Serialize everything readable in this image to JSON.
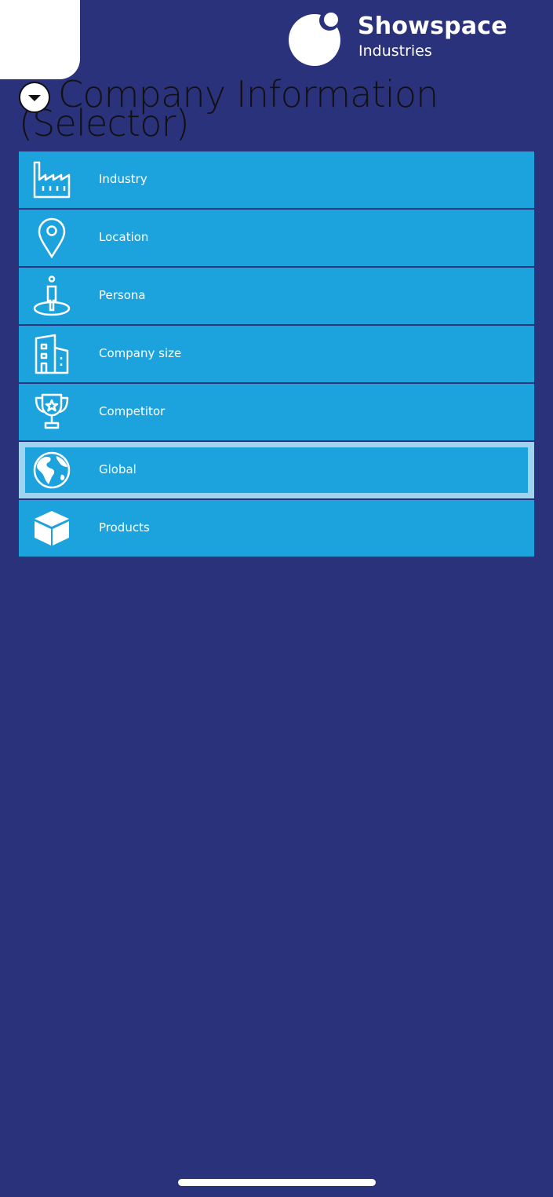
{
  "brand": {
    "name": "Showspace",
    "subtitle": "Industries"
  },
  "page": {
    "title": "Company Information (Selector)"
  },
  "list": {
    "items": [
      {
        "label": "Industry",
        "icon": "factory-icon"
      },
      {
        "label": "Location",
        "icon": "map-pin-icon"
      },
      {
        "label": "Persona",
        "icon": "person-icon"
      },
      {
        "label": "Company size",
        "icon": "building-icon"
      },
      {
        "label": "Competitor",
        "icon": "trophy-icon"
      },
      {
        "label": "Global",
        "icon": "globe-icon",
        "selected": true
      },
      {
        "label": "Products",
        "icon": "box-icon"
      }
    ]
  },
  "colors": {
    "background": "#2b327c",
    "row": "#1ca3dd",
    "selected_border": "#9fd3f0",
    "text": "#ffffff"
  }
}
